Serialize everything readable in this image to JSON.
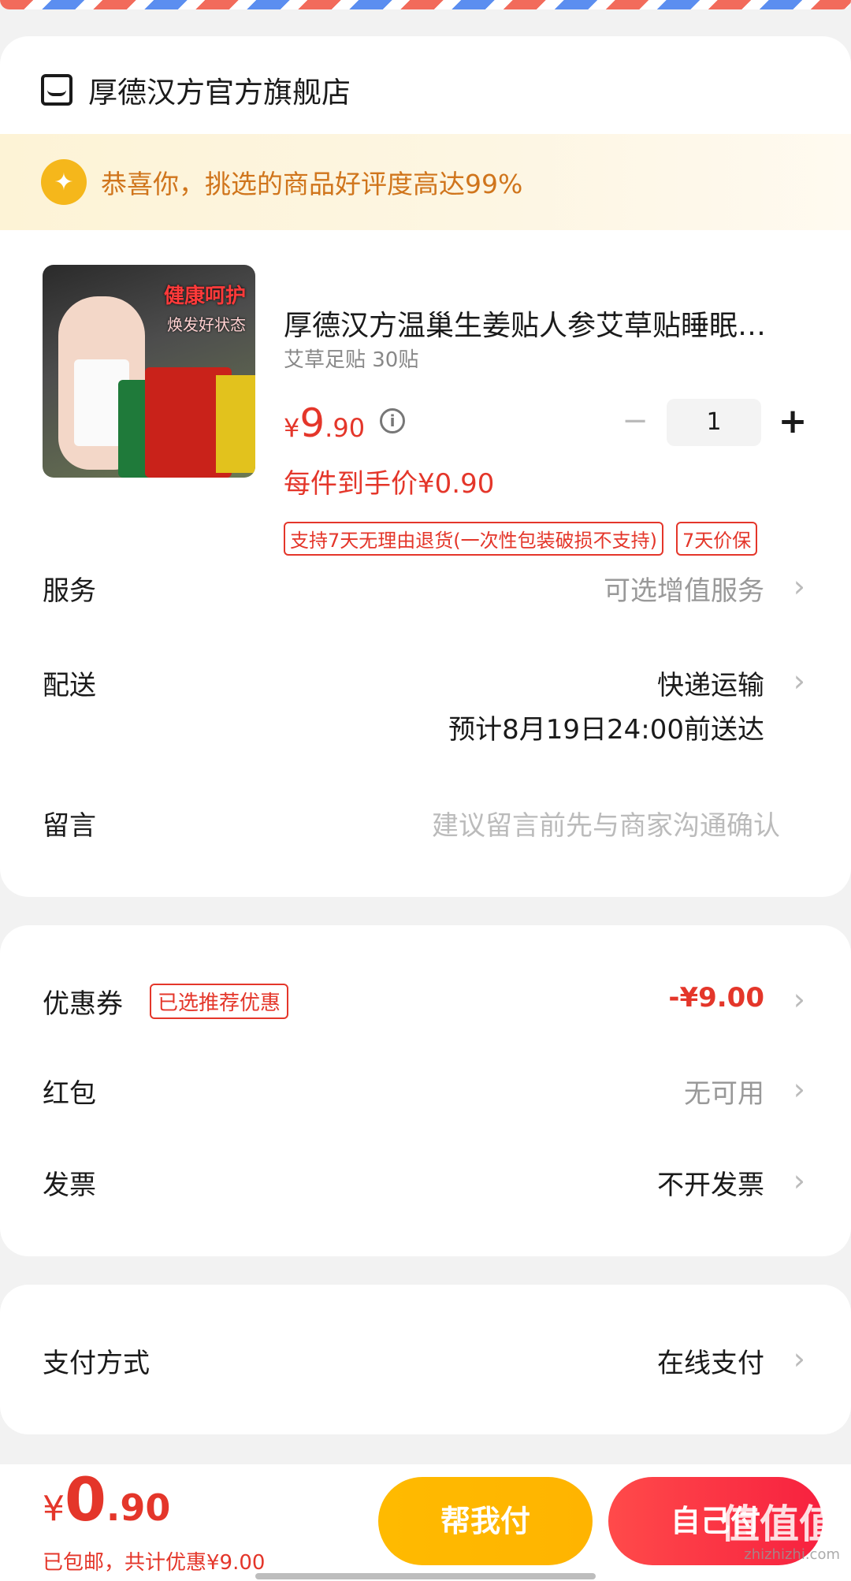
{
  "store": {
    "name": "厚德汉方官方旗舰店",
    "praise": "恭喜你，挑选的商品好评度高达99%"
  },
  "product": {
    "title": "厚德汉方温巢生姜贴人参艾草贴睡眠…",
    "sku": "艾草足贴 30贴",
    "price_currency": "¥",
    "price_int": "9",
    "price_dec": ".90",
    "info_icon": "i",
    "quantity": "1",
    "unit_price": "每件到手价¥0.90",
    "tags": [
      "支持7天无理由退货(一次性包装破损不支持)",
      "7天价保"
    ],
    "image_text_1": "健康呵护",
    "image_text_2": "焕发好状态"
  },
  "rows": {
    "service_label": "服务",
    "service_value": "可选增值服务",
    "delivery_label": "配送",
    "delivery_value": "快递运输",
    "delivery_eta": "预计8月19日24:00前送达",
    "note_label": "留言",
    "note_placeholder": "建议留言前先与商家沟通确认"
  },
  "discount": {
    "coupon_label": "优惠券",
    "coupon_tag": "已选推荐优惠",
    "coupon_value": "-¥9.00",
    "redpacket_label": "红包",
    "redpacket_value": "无可用",
    "invoice_label": "发票",
    "invoice_value": "不开发票"
  },
  "payment": {
    "label": "支付方式",
    "value": "在线支付"
  },
  "bottom": {
    "total_currency": "¥",
    "total_int": "0",
    "total_dec": ".90",
    "subtitle": "已包邮，共计优惠¥9.00",
    "btn_friend": "帮我付",
    "btn_self": "自己付",
    "watermark": "值值值",
    "watermark_url": "zhizhizhi.com"
  },
  "icons": {
    "chevron": "›",
    "minus": "−",
    "plus": "+",
    "thumb": "👍"
  },
  "colors": {
    "accent_red": "#e4362a",
    "praise_orange": "#d0751c",
    "button_yellow": "#ffb400",
    "button_red": "#f7213f"
  }
}
